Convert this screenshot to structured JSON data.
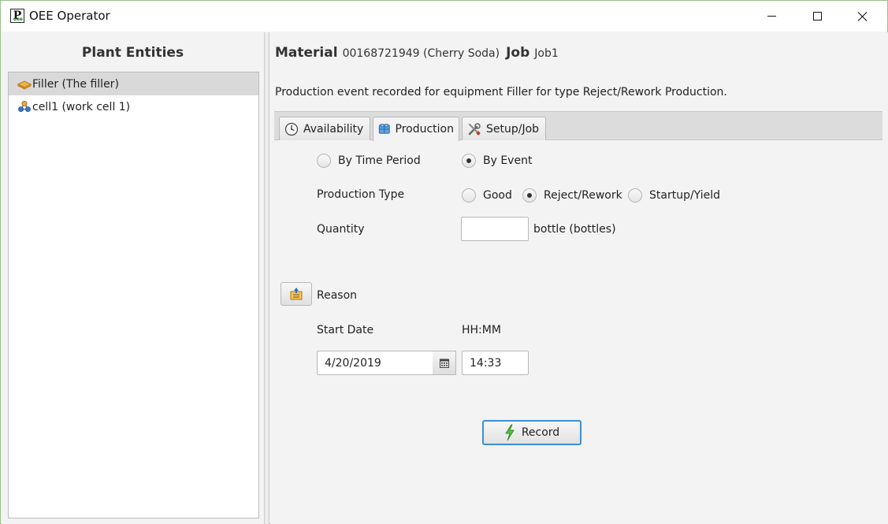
{
  "window": {
    "title": "OEE Operator"
  },
  "left": {
    "title": "Plant Entities",
    "items": [
      {
        "label": "Filler (The filler)",
        "icon": "equipment-icon",
        "selected": true
      },
      {
        "label": "cell1 (work cell 1)",
        "icon": "work-cell-icon",
        "selected": false
      }
    ]
  },
  "header": {
    "material_label": "Material",
    "material_value": "00168721949 (Cherry Soda)",
    "job_label": "Job",
    "job_value": "Job1"
  },
  "message": "Production event recorded for equipment Filler for type Reject/Rework Production.",
  "tabs": [
    {
      "label": "Availability",
      "icon": "clock-icon",
      "active": false
    },
    {
      "label": "Production",
      "icon": "production-icon",
      "active": true
    },
    {
      "label": "Setup/Job",
      "icon": "tools-icon",
      "active": false
    }
  ],
  "form": {
    "mode_by_time": "By Time Period",
    "mode_by_event": "By Event",
    "production_type_label": "Production Type",
    "type_good": "Good",
    "type_reject": "Reject/Rework",
    "type_startup": "Startup/Yield",
    "quantity_label": "Quantity",
    "quantity_value": "",
    "quantity_unit": "bottle (bottles)",
    "reason_label": "Reason",
    "start_date_label": "Start Date",
    "time_label": "HH:MM",
    "date_value": "4/20/2019",
    "time_value": "14:33",
    "record_label": "Record"
  }
}
